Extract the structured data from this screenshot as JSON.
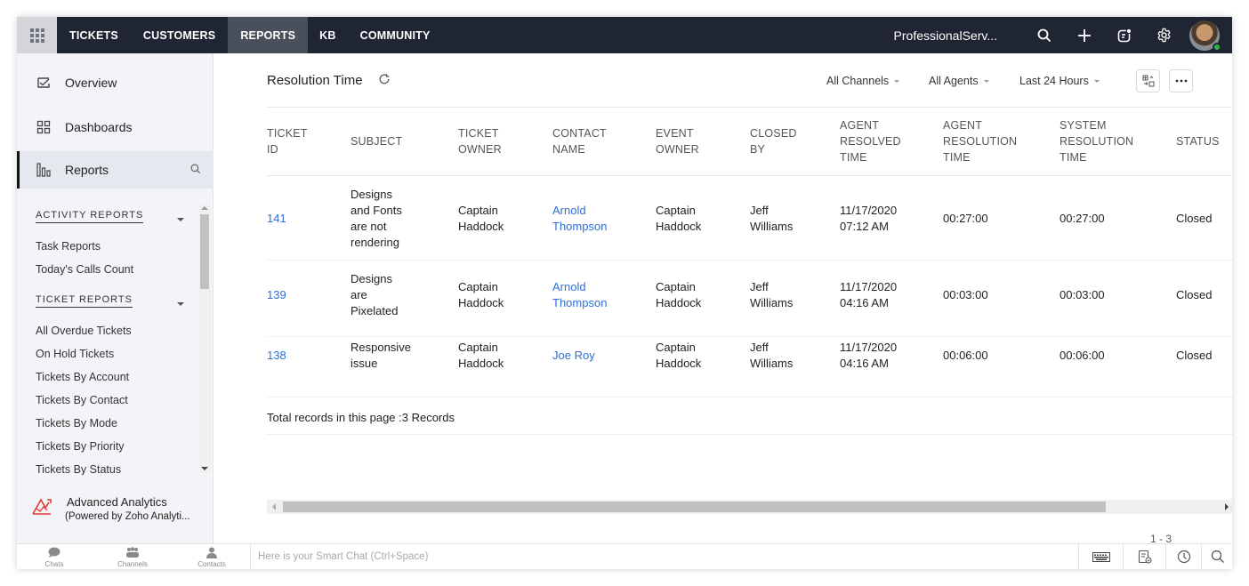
{
  "topnav": {
    "tabs": [
      {
        "label": "TICKETS",
        "active": false
      },
      {
        "label": "CUSTOMERS",
        "active": false
      },
      {
        "label": "REPORTS",
        "active": true
      },
      {
        "label": "KB",
        "active": false
      },
      {
        "label": "COMMUNITY",
        "active": false
      }
    ],
    "org_name": "ProfessionalServ...",
    "icons": [
      "search-icon",
      "plus-icon",
      "notes-icon",
      "gear-icon"
    ],
    "presence_color": "#2fb344"
  },
  "sidebar": {
    "main_items": [
      {
        "label": "Overview",
        "icon": "overview-icon"
      },
      {
        "label": "Dashboards",
        "icon": "dashboards-icon"
      },
      {
        "label": "Reports",
        "icon": "reports-icon",
        "active": true
      }
    ],
    "sections": [
      {
        "title": "ACTIVITY REPORTS",
        "items": [
          "Task Reports",
          "Today's Calls Count"
        ]
      },
      {
        "title": "TICKET REPORTS",
        "items": [
          "All Overdue Tickets",
          "On Hold Tickets",
          "Tickets By Account",
          "Tickets By Contact",
          "Tickets By Mode",
          "Tickets By Priority",
          "Tickets By Status"
        ]
      }
    ],
    "analytics": {
      "title": "Advanced Analytics",
      "subtitle": "(Powered by Zoho Analyti...",
      "color": "#e53935"
    }
  },
  "main": {
    "title": "Resolution Time",
    "filters": {
      "channels": "All Channels",
      "agents": "All Agents",
      "period": "Last 24 Hours"
    },
    "columns": [
      [
        "TICKET",
        "ID"
      ],
      [
        "SUBJECT"
      ],
      [
        "TICKET",
        "OWNER"
      ],
      [
        "CONTACT",
        "NAME"
      ],
      [
        "EVENT",
        "OWNER"
      ],
      [
        "CLOSED",
        "BY"
      ],
      [
        "AGENT",
        "RESOLVED",
        "TIME"
      ],
      [
        "AGENT",
        "RESOLUTION",
        "TIME"
      ],
      [
        "SYSTEM",
        "RESOLUTION",
        "TIME"
      ],
      [
        "STATUS"
      ]
    ],
    "rows": [
      {
        "ticket_id": "141",
        "subject": [
          "Designs",
          "and Fonts",
          "are not",
          "rendering"
        ],
        "ticket_owner": [
          "Captain",
          "Haddock"
        ],
        "contact_name": [
          "Arnold",
          "Thompson"
        ],
        "event_owner": [
          "Captain",
          "Haddock"
        ],
        "closed_by": [
          "Jeff",
          "Williams"
        ],
        "agent_resolved_time": [
          "11/17/2020",
          "07:12 AM"
        ],
        "agent_resolution_time": "00:27:00",
        "system_resolution_time": "00:27:00",
        "status": "Closed"
      },
      {
        "ticket_id": "139",
        "subject": [
          "Designs",
          "are",
          "Pixelated"
        ],
        "ticket_owner": [
          "Captain",
          "Haddock"
        ],
        "contact_name": [
          "Arnold",
          "Thompson"
        ],
        "event_owner": [
          "Captain",
          "Haddock"
        ],
        "closed_by": [
          "Jeff",
          "Williams"
        ],
        "agent_resolved_time": [
          "11/17/2020",
          "04:16 AM"
        ],
        "agent_resolution_time": "00:03:00",
        "system_resolution_time": "00:03:00",
        "status": "Closed"
      },
      {
        "ticket_id": "138",
        "subject": [
          "Responsive",
          "issue"
        ],
        "ticket_owner": [
          "Captain",
          "Haddock"
        ],
        "contact_name": [
          "Joe Roy"
        ],
        "event_owner": [
          "Captain",
          "Haddock"
        ],
        "closed_by": [
          "Jeff",
          "Williams"
        ],
        "agent_resolved_time": [
          "11/17/2020",
          "04:16 AM"
        ],
        "agent_resolution_time": "00:06:00",
        "system_resolution_time": "00:06:00",
        "status": "Closed"
      }
    ],
    "total_records": "Total records in this page :3 Records",
    "pagination": "1 - 3",
    "link_color": "#2f6fd6"
  },
  "bottombar": {
    "items": [
      {
        "label": "Chats",
        "icon": "chat-bubble-icon"
      },
      {
        "label": "Channels",
        "icon": "channels-icon"
      },
      {
        "label": "Contacts",
        "icon": "contact-icon"
      }
    ],
    "smart_chat_placeholder": "Here is your Smart Chat (Ctrl+Space)",
    "smart_chat_value": "",
    "tools": [
      "keyboard-icon",
      "notes-check-icon",
      "clock-icon",
      "search-icon"
    ]
  }
}
